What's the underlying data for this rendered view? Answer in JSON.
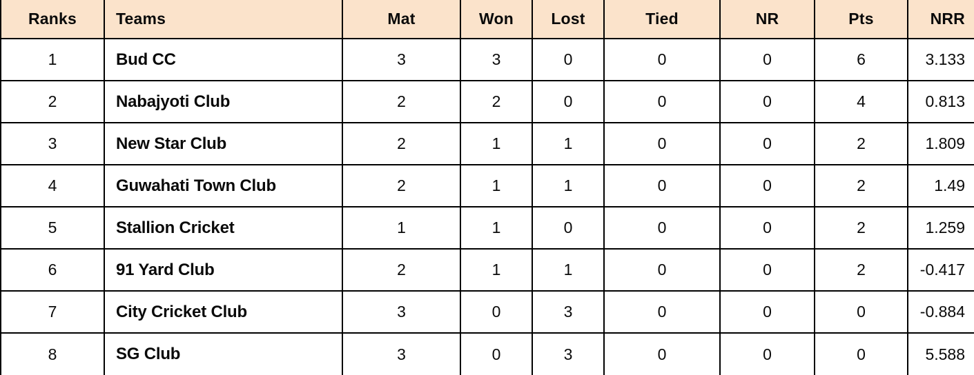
{
  "table": {
    "name": "points-table",
    "header_bg": "#fbe3cb",
    "border_color": "#000000",
    "columns": [
      {
        "key": "rank",
        "label": "Ranks",
        "align": "center"
      },
      {
        "key": "team",
        "label": "Teams",
        "align": "left"
      },
      {
        "key": "mat",
        "label": "Mat",
        "align": "center"
      },
      {
        "key": "won",
        "label": "Won",
        "align": "center"
      },
      {
        "key": "lost",
        "label": "Lost",
        "align": "center"
      },
      {
        "key": "tied",
        "label": "Tied",
        "align": "center"
      },
      {
        "key": "nr",
        "label": "NR",
        "align": "center"
      },
      {
        "key": "pts",
        "label": "Pts",
        "align": "center"
      },
      {
        "key": "nrr",
        "label": "NRR",
        "align": "right"
      }
    ],
    "rows": [
      {
        "rank": "1",
        "team": "Bud CC",
        "mat": "3",
        "won": "3",
        "lost": "0",
        "tied": "0",
        "nr": "0",
        "pts": "6",
        "nrr": "3.133"
      },
      {
        "rank": "2",
        "team": "Nabajyoti Club",
        "mat": "2",
        "won": "2",
        "lost": "0",
        "tied": "0",
        "nr": "0",
        "pts": "4",
        "nrr": "0.813"
      },
      {
        "rank": "3",
        "team": "New Star Club",
        "mat": "2",
        "won": "1",
        "lost": "1",
        "tied": "0",
        "nr": "0",
        "pts": "2",
        "nrr": "1.809"
      },
      {
        "rank": "4",
        "team": "Guwahati Town Club",
        "mat": "2",
        "won": "1",
        "lost": "1",
        "tied": "0",
        "nr": "0",
        "pts": "2",
        "nrr": "1.49"
      },
      {
        "rank": "5",
        "team": "Stallion Cricket",
        "mat": "1",
        "won": "1",
        "lost": "0",
        "tied": "0",
        "nr": "0",
        "pts": "2",
        "nrr": "1.259"
      },
      {
        "rank": "6",
        "team": "91 Yard Club",
        "mat": "2",
        "won": "1",
        "lost": "1",
        "tied": "0",
        "nr": "0",
        "pts": "2",
        "nrr": "-0.417"
      },
      {
        "rank": "7",
        "team": "City Cricket Club",
        "mat": "3",
        "won": "0",
        "lost": "3",
        "tied": "0",
        "nr": "0",
        "pts": "0",
        "nrr": "-0.884"
      },
      {
        "rank": "8",
        "team": "SG Club",
        "mat": "3",
        "won": "0",
        "lost": "3",
        "tied": "0",
        "nr": "0",
        "pts": "0",
        "nrr": "5.588"
      }
    ]
  }
}
